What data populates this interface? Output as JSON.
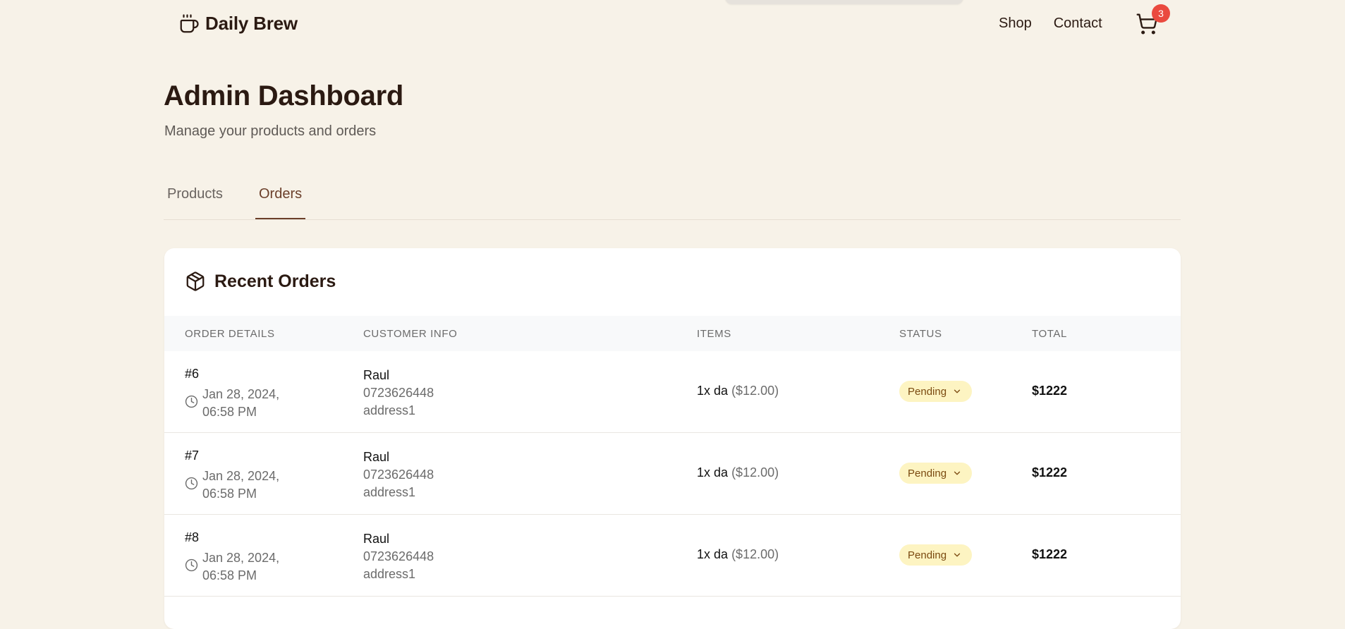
{
  "header": {
    "brand": "Daily Brew",
    "nav": [
      {
        "label": "Shop"
      },
      {
        "label": "Contact"
      }
    ],
    "cart_count": "3"
  },
  "page": {
    "title": "Admin Dashboard",
    "subtitle": "Manage your products and orders"
  },
  "tabs": [
    {
      "label": "Products",
      "active": false
    },
    {
      "label": "Orders",
      "active": true
    }
  ],
  "orders": {
    "title": "Recent Orders",
    "columns": [
      "ORDER DETAILS",
      "CUSTOMER INFO",
      "ITEMS",
      "STATUS",
      "TOTAL"
    ],
    "rows": [
      {
        "id": "#6",
        "date": "Jan 28, 2024, 06:58 PM",
        "customer": "Raul",
        "phone": "0723626448",
        "address": "address1",
        "items": "1x da",
        "item_price": "($12.00)",
        "status": "Pending",
        "total": "$1222"
      },
      {
        "id": "#7",
        "date": "Jan 28, 2024, 06:58 PM",
        "customer": "Raul",
        "phone": "0723626448",
        "address": "address1",
        "items": "1x da",
        "item_price": "($12.00)",
        "status": "Pending",
        "total": "$1222"
      },
      {
        "id": "#8",
        "date": "Jan 28, 2024, 06:58 PM",
        "customer": "Raul",
        "phone": "0723626448",
        "address": "address1",
        "items": "1x da",
        "item_price": "($12.00)",
        "status": "Pending",
        "total": "$1222"
      }
    ]
  },
  "colors": {
    "background": "#f7f2e8",
    "brand_dark": "#2b1a12",
    "accent": "#6b3f2a",
    "badge": "#ea4a3f",
    "pending_bg": "#fdf4c2",
    "pending_text": "#7a4a10"
  },
  "icons": {
    "logo": "coffee-cup-icon",
    "cart": "shopping-cart-icon",
    "orders": "package-icon",
    "date": "clock-icon",
    "status": "chevron-down-icon"
  }
}
